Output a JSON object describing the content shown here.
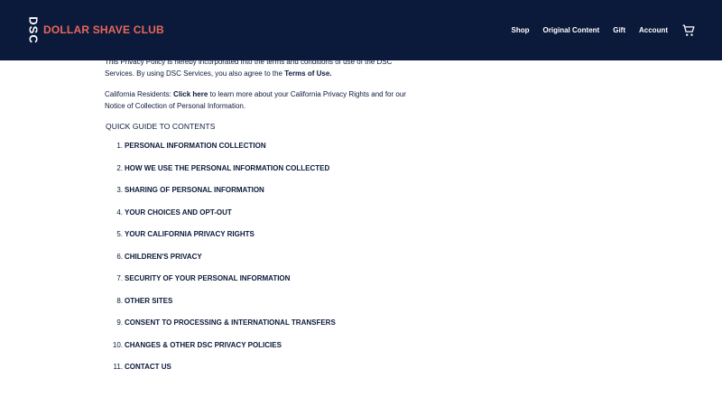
{
  "header": {
    "logo_mark": "DSC",
    "logo_text": "DOLLAR SHAVE CLUB",
    "nav": [
      "Shop",
      "Original Content",
      "Gift",
      "Account"
    ],
    "colors": {
      "background": "#0b1a3a",
      "accent": "#e8675b"
    },
    "cart_icon": "cart-icon"
  },
  "intro": {
    "text": "This Privacy Policy is hereby incorporated into the terms and conditions of use of the DSC Services. By using DSC Services, you also agree to the ",
    "terms_link": "Terms of Use."
  },
  "california": {
    "prefix": "California Residents: ",
    "link": "Click here",
    "text": " to learn more about your California Privacy Rights and for our Notice of Collection of Personal Information."
  },
  "quick_guide": "QUICK GUIDE TO CONTENTS",
  "toc": [
    {
      "num": "1.",
      "label": "PERSONAL INFORMATION COLLECTION"
    },
    {
      "num": "2.",
      "label": "HOW WE USE THE PERSONAL INFORMATION COLLECTED"
    },
    {
      "num": "3.",
      "label": "SHARING OF PERSONAL INFORMATION"
    },
    {
      "num": "4.",
      "label": "YOUR CHOICES AND OPT-OUT"
    },
    {
      "num": "5.",
      "label": "YOUR CALIFORNIA PRIVACY RIGHTS"
    },
    {
      "num": "6.",
      "label": "CHILDREN'S PRIVACY"
    },
    {
      "num": "7.",
      "label": "SECURITY OF YOUR PERSONAL INFORMATION"
    },
    {
      "num": "8.",
      "label": "OTHER SITES"
    },
    {
      "num": "9.",
      "label": "CONSENT TO PROCESSING & INTERNATIONAL TRANSFERS"
    },
    {
      "num": "10.",
      "label": "CHANGES & OTHER DSC PRIVACY POLICIES"
    },
    {
      "num": "11.",
      "label": "CONTACT US"
    }
  ]
}
